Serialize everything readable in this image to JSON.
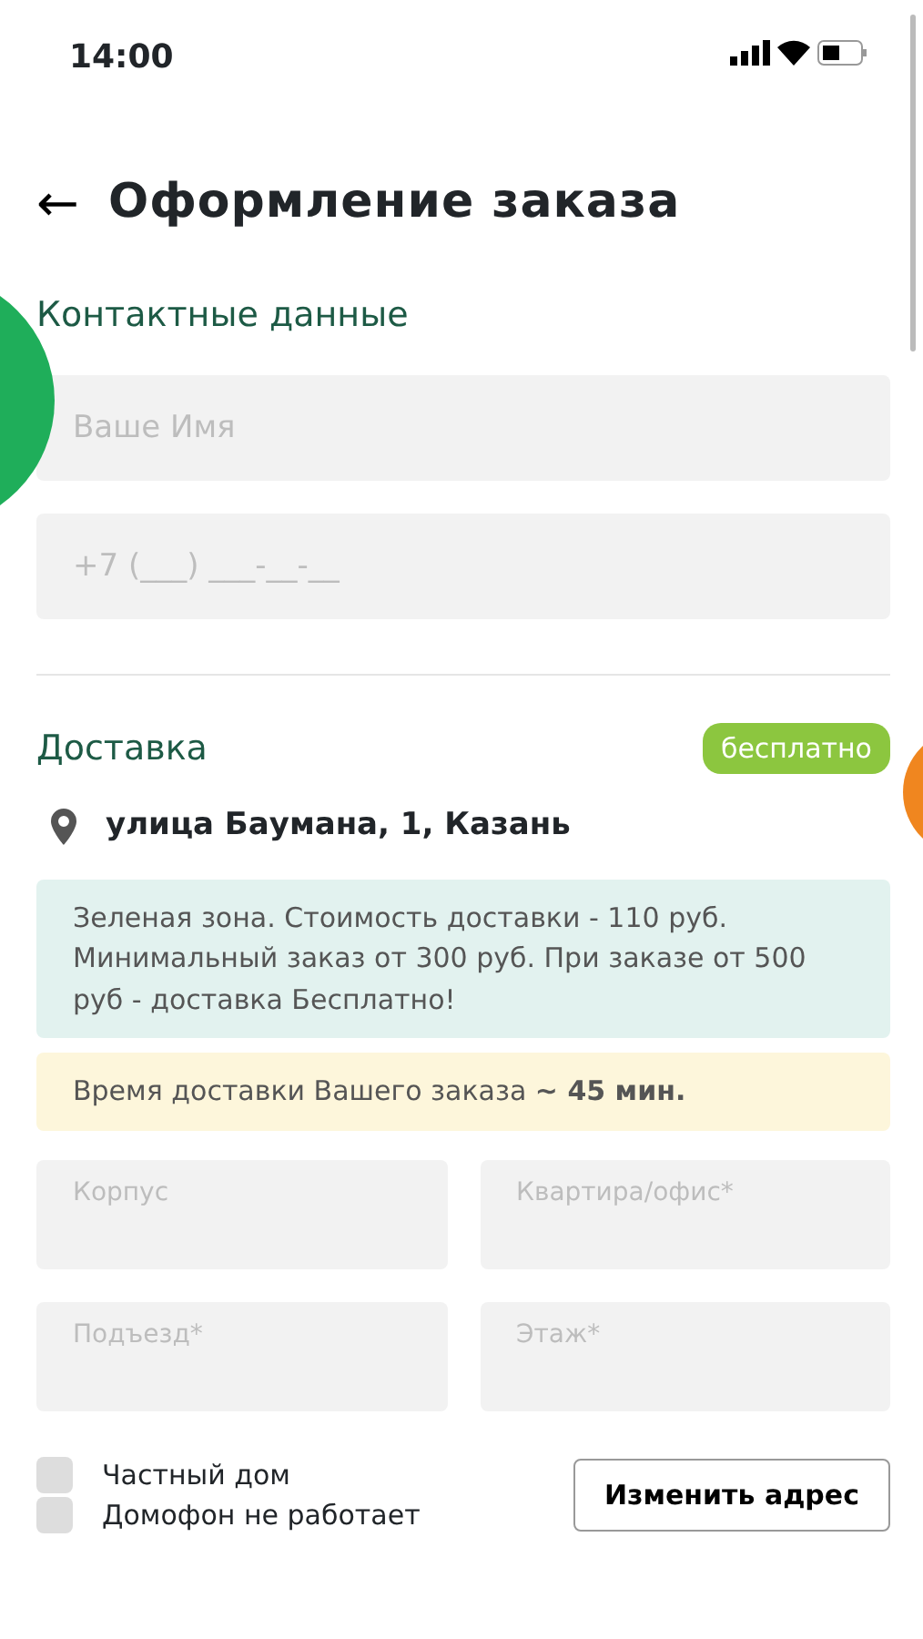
{
  "status_bar": {
    "time": "14:00"
  },
  "header": {
    "back": "←",
    "title": "Оформление заказа"
  },
  "contact": {
    "title": "Контактные данные",
    "fields": [
      {
        "placeholder": "Ваше Имя"
      },
      {
        "placeholder": "+7 (___) ___-__-__"
      }
    ]
  },
  "delivery": {
    "title": "Доставка",
    "badge": "бесплатно",
    "address": "улица Баумана, 1, Казань",
    "notes": [
      {
        "kind": "zone",
        "text": "Зеленая зона. Стоимость доставки - 110 руб. Минимальный заказ от 300 руб. При заказе от 500 руб - доставка Бесплатно!"
      },
      {
        "kind": "time",
        "text": "Время доставки Вашего заказа **~ 45 мин.**"
      }
    ],
    "fields": [
      {
        "placeholder": "Корпус"
      },
      {
        "placeholder": "Квартира/офис*"
      },
      {
        "placeholder": "Подъезд*"
      },
      {
        "placeholder": "Этаж*"
      }
    ],
    "options": [
      {
        "label": "Частный дом",
        "checked": false
      },
      {
        "label": "Домофон не работает",
        "checked": false
      }
    ],
    "button": "Изменить адрес"
  }
}
